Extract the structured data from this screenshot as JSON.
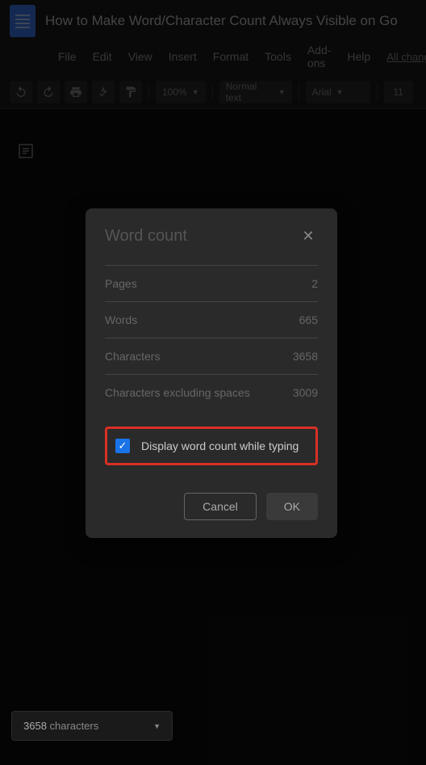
{
  "header": {
    "title": "How to Make Word/Character Count Always Visible on Go",
    "menu": [
      "File",
      "Edit",
      "View",
      "Insert",
      "Format",
      "Tools",
      "Add-ons",
      "Help"
    ],
    "changes_link": "All chang"
  },
  "toolbar": {
    "zoom": "100%",
    "style": "Normal text",
    "font": "Arial",
    "size": "11"
  },
  "dialog": {
    "title": "Word count",
    "stats": [
      {
        "label": "Pages",
        "value": "2"
      },
      {
        "label": "Words",
        "value": "665"
      },
      {
        "label": "Characters",
        "value": "3658"
      },
      {
        "label": "Characters excluding spaces",
        "value": "3009"
      }
    ],
    "checkbox_label": "Display word count while typing",
    "cancel": "Cancel",
    "ok": "OK"
  },
  "pill": {
    "count": "3658",
    "label": "characters"
  }
}
